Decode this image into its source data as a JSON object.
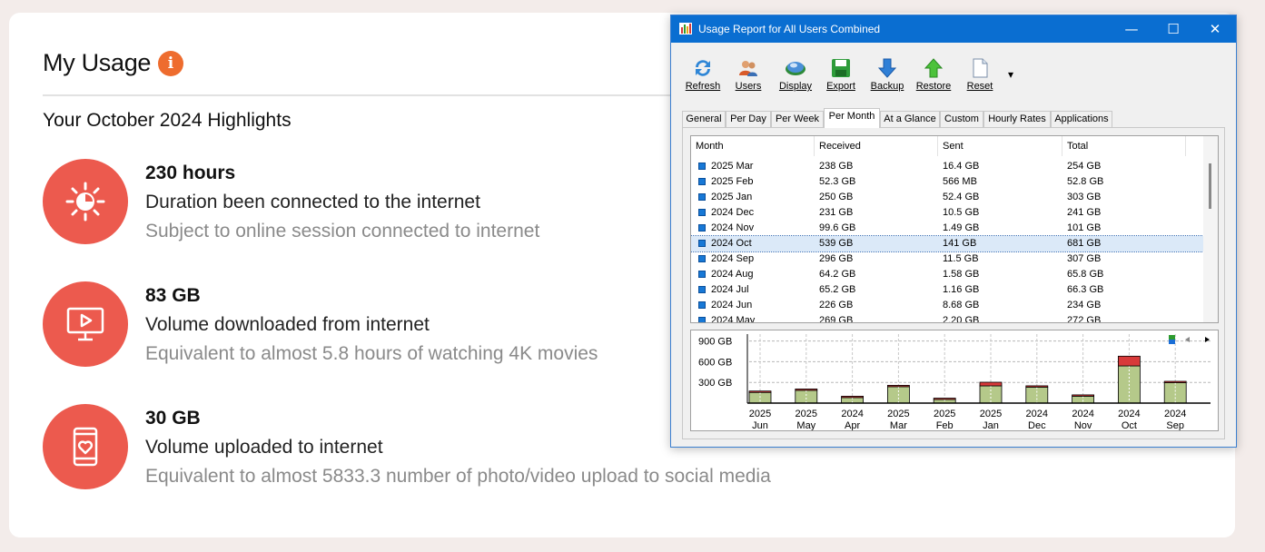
{
  "page": {
    "title": "My Usage",
    "info_icon": "i",
    "subtitle": "Your October 2024 Highlights",
    "highlights": [
      {
        "icon": "sun-clock-icon",
        "value": "230 hours",
        "description": "Duration been connected to the internet",
        "note": "Subject to online session connected to internet"
      },
      {
        "icon": "monitor-play-icon",
        "value": "83 GB",
        "description": "Volume downloaded from internet",
        "note": "Equivalent to almost 5.8 hours of watching 4K movies"
      },
      {
        "icon": "phone-heart-icon",
        "value": "30 GB",
        "description": "Volume uploaded to internet",
        "note": "Equivalent to almost 5833.3 number of photo/video upload to social media"
      }
    ],
    "accent": "#ec5a4e",
    "info_color": "#ee6c2e"
  },
  "window": {
    "title": "Usage Report for All Users Combined",
    "controls": {
      "minimize": "—",
      "maximize": "☐",
      "close": "✕"
    },
    "toolbar": [
      {
        "label": "Refresh",
        "icon": "refresh-icon"
      },
      {
        "label": "Users",
        "icon": "users-icon"
      },
      {
        "label": "Display",
        "icon": "display-icon"
      },
      {
        "label": "Export",
        "icon": "save-icon"
      },
      {
        "label": "Backup",
        "icon": "down-arrow-icon"
      },
      {
        "label": "Restore",
        "icon": "up-arrow-icon"
      },
      {
        "label": "Reset",
        "icon": "document-icon"
      }
    ],
    "toolbar_more": "▾",
    "tabs": [
      "General",
      "Per Day",
      "Per Week",
      "Per Month",
      "At a Glance",
      "Custom",
      "Hourly Rates",
      "Applications"
    ],
    "active_tab": "Per Month",
    "columns": [
      "Month",
      "Received",
      "Sent",
      "Total"
    ],
    "rows": [
      {
        "month": "2025 Mar",
        "received": "238 GB",
        "sent": "16.4 GB",
        "total": "254 GB"
      },
      {
        "month": "2025 Feb",
        "received": "52.3 GB",
        "sent": "566 MB",
        "total": "52.8 GB"
      },
      {
        "month": "2025 Jan",
        "received": "250 GB",
        "sent": "52.4 GB",
        "total": "303 GB"
      },
      {
        "month": "2024 Dec",
        "received": "231 GB",
        "sent": "10.5 GB",
        "total": "241 GB"
      },
      {
        "month": "2024 Nov",
        "received": "99.6 GB",
        "sent": "1.49 GB",
        "total": "101 GB"
      },
      {
        "month": "2024 Oct",
        "received": "539 GB",
        "sent": "141 GB",
        "total": "681 GB",
        "selected": true
      },
      {
        "month": "2024 Sep",
        "received": "296 GB",
        "sent": "11.5 GB",
        "total": "307 GB"
      },
      {
        "month": "2024 Aug",
        "received": "64.2 GB",
        "sent": "1.58 GB",
        "total": "65.8 GB"
      },
      {
        "month": "2024 Jul",
        "received": "65.2 GB",
        "sent": "1.16 GB",
        "total": "66.3 GB"
      },
      {
        "month": "2024 Jun",
        "received": "226 GB",
        "sent": "8.68 GB",
        "total": "234 GB"
      },
      {
        "month": "2024 May",
        "received": "269 GB",
        "sent": "2.20 GB",
        "total": "272 GB"
      }
    ]
  },
  "chart_data": {
    "type": "bar",
    "stacked": true,
    "categories": [
      "2025 Jun",
      "2025 May",
      "2024 Apr",
      "2025 Mar",
      "2025 Feb",
      "2025 Jan",
      "2024 Dec",
      "2024 Nov",
      "2024 Oct",
      "2024 Sep"
    ],
    "category_lines": [
      [
        "2025",
        "Jun"
      ],
      [
        "2025",
        "May"
      ],
      [
        "2024",
        "Apr"
      ],
      [
        "2025",
        "Mar"
      ],
      [
        "2025",
        "Feb"
      ],
      [
        "2025",
        "Jan"
      ],
      [
        "2024",
        "Dec"
      ],
      [
        "2024",
        "Nov"
      ],
      [
        "2024",
        "Oct"
      ],
      [
        "2024",
        "Sep"
      ]
    ],
    "series": [
      {
        "values": [
          155,
          185,
          80,
          238,
          52.3,
          250,
          231,
          99.6,
          539,
          296
        ],
        "color": "#b5c98a"
      },
      {
        "values": [
          20,
          15,
          18,
          16.4,
          0.566,
          52.4,
          10.5,
          1.49,
          141,
          11.5
        ],
        "color": "#d83a3a"
      }
    ],
    "yticks": [
      "900 GB",
      "600 GB",
      "300 GB"
    ],
    "ylim": [
      0,
      1000
    ],
    "grid": true
  }
}
